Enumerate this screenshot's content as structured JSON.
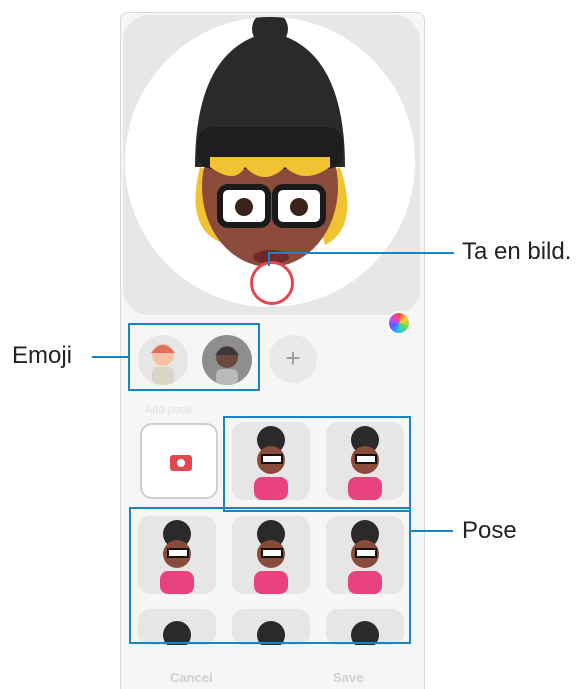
{
  "callouts": {
    "capture": "Ta en bild.",
    "emoji": "Emoji",
    "pose": "Pose"
  },
  "emoji_bar": {
    "add_label": "+"
  },
  "pose_section": {
    "label": "Add pose"
  },
  "actions": {
    "cancel": "Cancel",
    "save": "Save"
  },
  "colors": {
    "accent": "#1a85c2",
    "shutter": "#e6474f"
  }
}
